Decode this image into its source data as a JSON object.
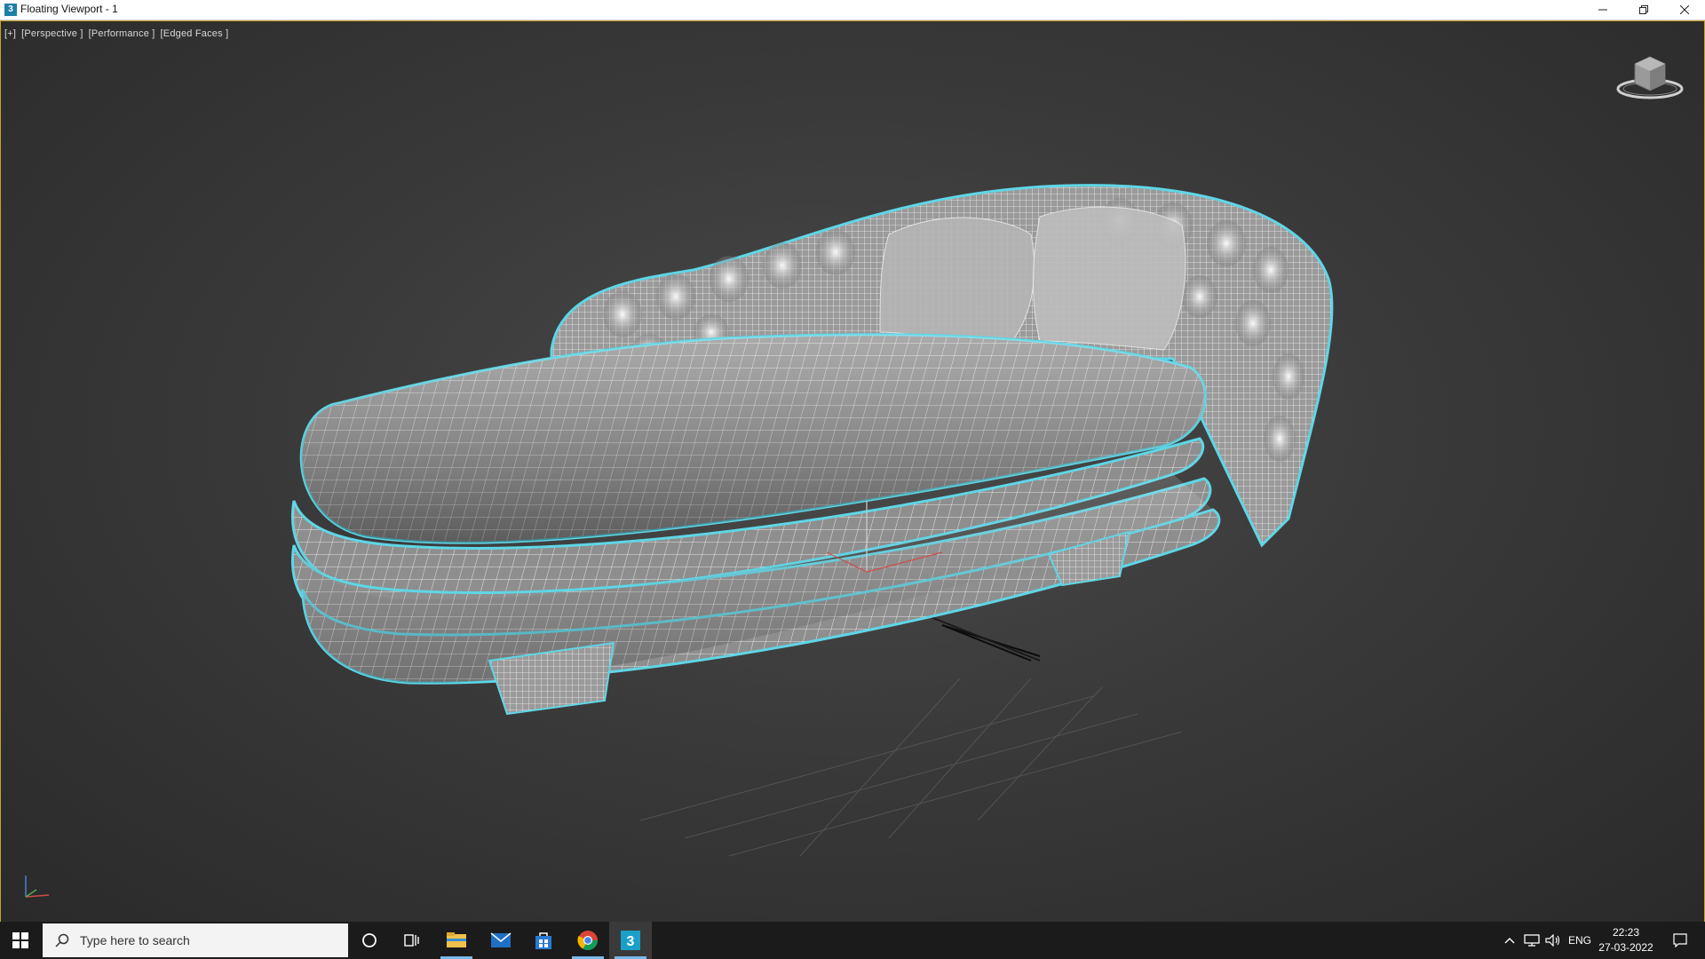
{
  "window": {
    "title": "Floating Viewport - 1",
    "app_icon": "3ds-max-icon",
    "controls": {
      "minimize": "minimize-icon",
      "restore": "restore-icon",
      "close": "close-icon"
    }
  },
  "viewport": {
    "labels": [
      "[+]",
      "[Perspective ]",
      "[Performance ]",
      "[Edged Faces ]"
    ],
    "border_color": "#c9a227",
    "wire_color": "#ffffff",
    "selection_outline": "#5fd6e6"
  },
  "taskbar": {
    "search_placeholder": "Type here to search",
    "pinned": [
      {
        "name": "cortana",
        "icon": "circle-icon"
      },
      {
        "name": "task-view",
        "icon": "task-view-icon"
      },
      {
        "name": "file-explorer",
        "icon": "folder-icon"
      },
      {
        "name": "mail",
        "icon": "mail-icon"
      },
      {
        "name": "store",
        "icon": "store-icon"
      },
      {
        "name": "chrome",
        "icon": "chrome-icon"
      },
      {
        "name": "3ds-max",
        "icon": "3ds-max-icon"
      }
    ],
    "tray": {
      "language": "ENG",
      "time": "22:23",
      "date": "27-03-2022"
    }
  }
}
